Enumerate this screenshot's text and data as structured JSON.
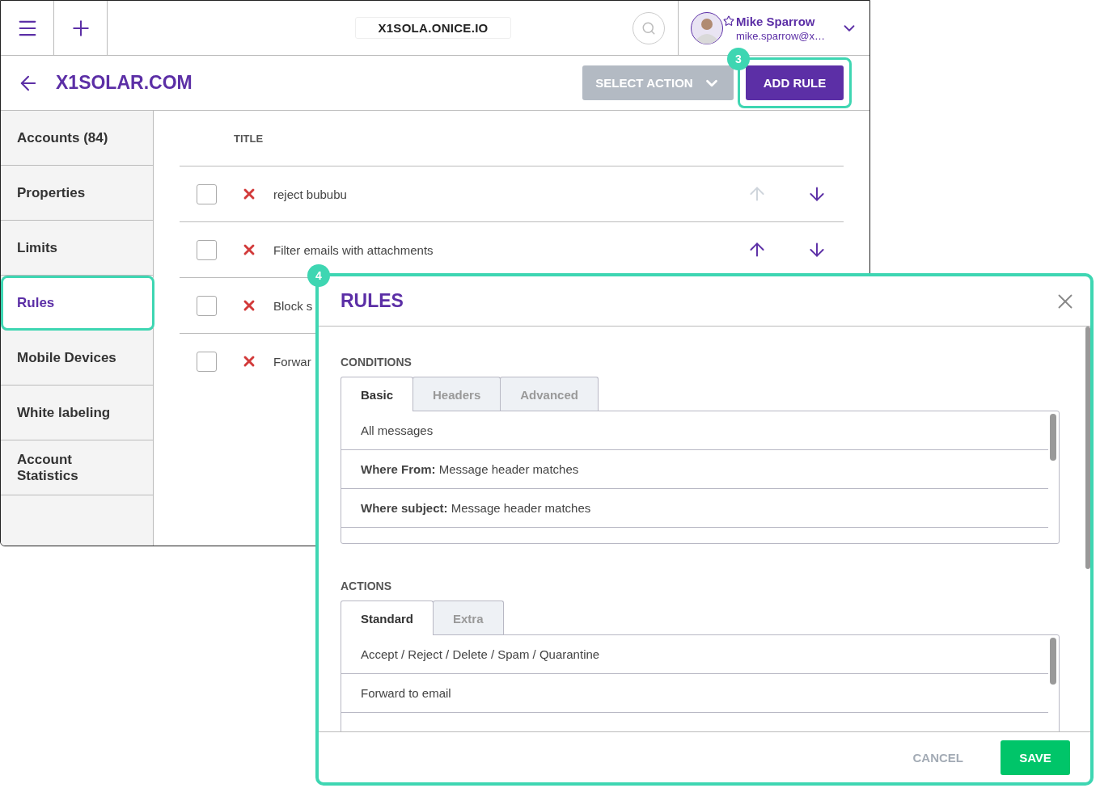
{
  "header": {
    "domain": "X1SOLA.ONICE.IO",
    "user": {
      "name": "Mike Sparrow",
      "email": "mike.sparrow@x…"
    }
  },
  "toolbar": {
    "title": "X1SOLAR.COM",
    "select_action": {
      "label": "SELECT ACTION",
      "disabled": true
    },
    "add_rule": {
      "label": "ADD RULE",
      "badge": "3"
    }
  },
  "sidebar": {
    "items": [
      {
        "label": "Accounts (84)",
        "selected": false
      },
      {
        "label": "Properties",
        "selected": false
      },
      {
        "label": "Limits",
        "selected": false
      },
      {
        "label": "Rules",
        "selected": true
      },
      {
        "label": "Mobile Devices",
        "selected": false
      },
      {
        "label": "White labeling",
        "selected": false
      },
      {
        "label": "Account Statistics",
        "selected": false
      }
    ]
  },
  "table": {
    "columns": [
      "TITLE"
    ],
    "rows": [
      {
        "title": "reject bububu",
        "checked": false,
        "move_up": {
          "disabled": true
        },
        "move_down": {
          "disabled": false
        }
      },
      {
        "title": "Filter emails with attachments",
        "checked": false,
        "move_up": {
          "disabled": false
        },
        "move_down": {
          "disabled": false
        }
      },
      {
        "title": "Block s",
        "checked": false
      },
      {
        "title": "Forwar",
        "checked": false
      }
    ]
  },
  "modal": {
    "badge": "4",
    "title": "RULES",
    "sections": [
      {
        "label": "CONDITIONS",
        "tabs": [
          {
            "label": "Basic",
            "selected": true
          },
          {
            "label": "Headers",
            "selected": false
          },
          {
            "label": "Advanced",
            "selected": false
          }
        ],
        "items": [
          "All messages",
          "**Where From:** Message header matches",
          "**Where subject:** Message header matches"
        ]
      },
      {
        "label": "ACTIONS",
        "tabs": [
          {
            "label": "Standard",
            "selected": true
          },
          {
            "label": "Extra",
            "selected": false
          }
        ],
        "items": [
          "Accept / Reject / Delete / Spam / Quarantine",
          "Forward to email"
        ]
      }
    ],
    "cancel": {
      "label": "CANCEL",
      "disabled": true
    },
    "save": {
      "label": "SAVE"
    }
  }
}
